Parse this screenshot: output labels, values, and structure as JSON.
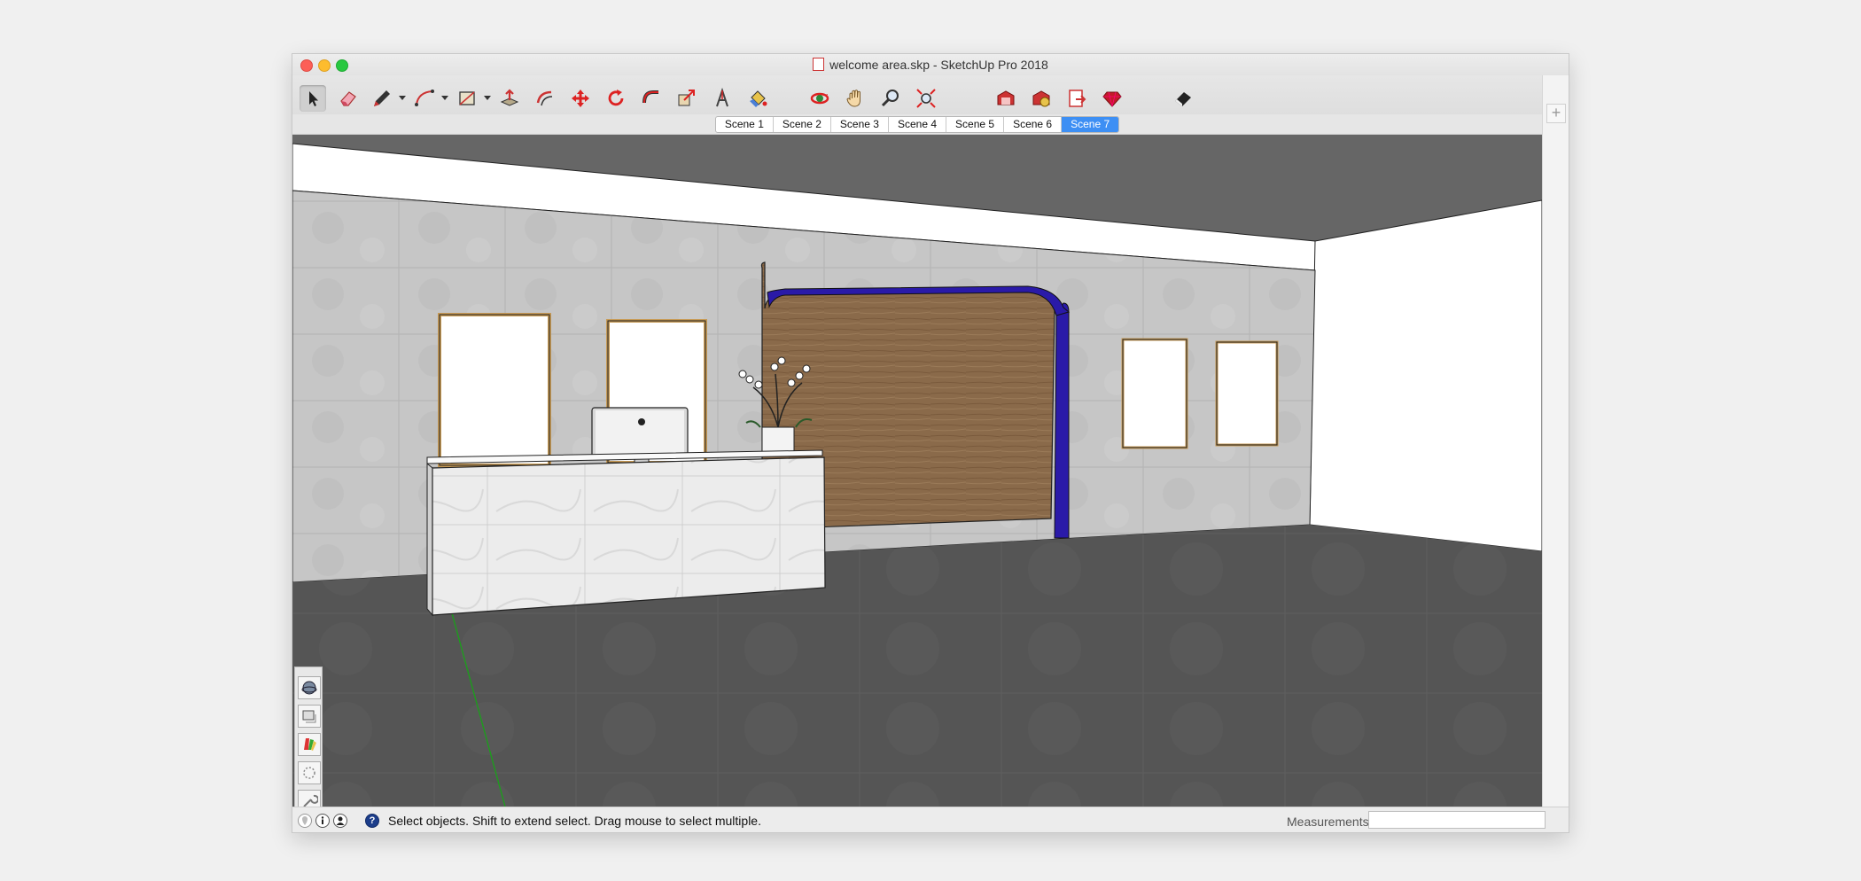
{
  "window": {
    "title": "welcome area.skp - SketchUp Pro 2018"
  },
  "toolbar": {
    "tools": [
      {
        "name": "select-tool",
        "icon": "arrow-cursor-icon"
      },
      {
        "name": "eraser-tool",
        "icon": "eraser-icon"
      },
      {
        "name": "line-tool",
        "icon": "pencil-icon"
      },
      {
        "name": "arc-tool",
        "icon": "arc-icon"
      },
      {
        "name": "shape-tool",
        "icon": "rectangle-icon"
      },
      {
        "name": "push-pull-tool",
        "icon": "push-pull-icon"
      },
      {
        "name": "offset-tool",
        "icon": "offset-icon"
      },
      {
        "name": "move-tool",
        "icon": "move-arrows-icon"
      },
      {
        "name": "rotate-tool",
        "icon": "rotate-icon"
      },
      {
        "name": "follow-me-tool",
        "icon": "follow-me-icon"
      },
      {
        "name": "scale-tool",
        "icon": "scale-icon"
      },
      {
        "name": "text-tool",
        "icon": "text-icon"
      },
      {
        "name": "paint-bucket-tool",
        "icon": "paint-bucket-icon"
      },
      {
        "name": "orbit-tool",
        "icon": "orbit-icon"
      },
      {
        "name": "pan-tool",
        "icon": "hand-icon"
      },
      {
        "name": "zoom-tool",
        "icon": "magnifier-icon"
      },
      {
        "name": "zoom-extents-tool",
        "icon": "zoom-extents-icon"
      },
      {
        "name": "warehouse-tool",
        "icon": "warehouse-icon"
      },
      {
        "name": "extension-warehouse-tool",
        "icon": "extension-icon"
      },
      {
        "name": "layout-tool",
        "icon": "layout-icon"
      },
      {
        "name": "ruby-tool",
        "icon": "ruby-icon"
      },
      {
        "name": "style-tool",
        "icon": "style-icon"
      }
    ]
  },
  "scenes": {
    "tabs": [
      "Scene 1",
      "Scene 2",
      "Scene 3",
      "Scene 4",
      "Scene 5",
      "Scene 6",
      "Scene 7"
    ],
    "active_index": 6
  },
  "viewport_tools": [
    {
      "name": "materials-panel-button",
      "icon": "sphere-icon"
    },
    {
      "name": "components-panel-button",
      "icon": "components-icon"
    },
    {
      "name": "styles-panel-button",
      "icon": "styles-icon"
    },
    {
      "name": "scenes-panel-button",
      "icon": "shadow-icon"
    },
    {
      "name": "tools-panel-button",
      "icon": "wrench-icon"
    },
    {
      "name": "model-info-button",
      "icon": "box-icon"
    },
    {
      "name": "instructor-button",
      "icon": "lightbulb-icon"
    }
  ],
  "status": {
    "message": "Select objects. Shift to extend select. Drag mouse to select multiple.",
    "measurements_label": "Measurements",
    "measurements_value": ""
  },
  "colors": {
    "accent": "#3d8ff4",
    "ceiling": "#666666",
    "floor": "#545454",
    "wall": "#c4c4c4",
    "wood": "#8a6a4a",
    "arch_trim": "#2a1aa8",
    "frame": "#c79a55"
  }
}
